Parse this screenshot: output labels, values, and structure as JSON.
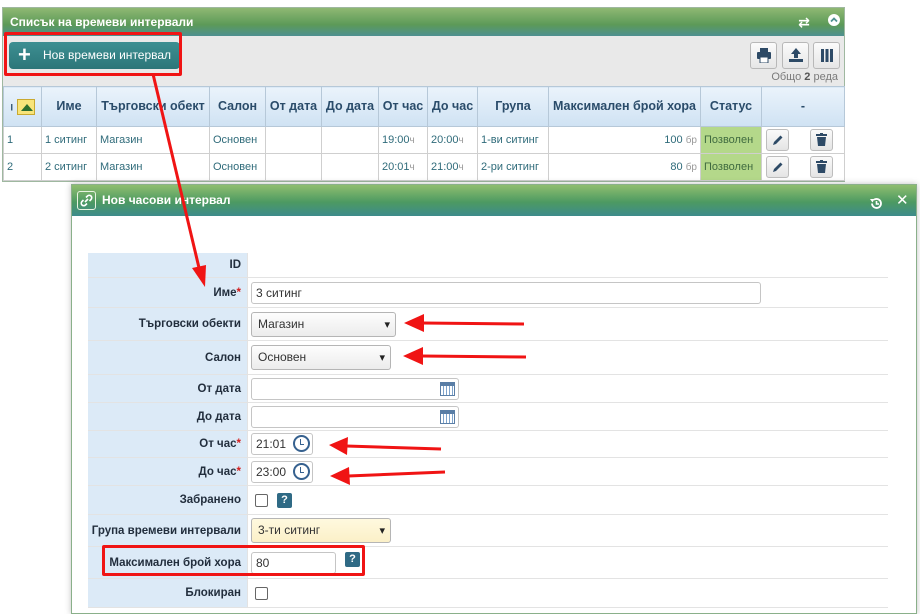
{
  "list_panel": {
    "title": "Списък на времеви интервали",
    "add_button_label": "Нов времеви интервал",
    "total_prefix": "Общо",
    "total_count": "2",
    "total_suffix": "реда",
    "columns": [
      "I",
      "Име",
      "Търговски обект",
      "Салон",
      "От дата",
      "До дата",
      "От час",
      "До час",
      "Група",
      "Максимален брой хора",
      "Статус",
      "-"
    ],
    "rows": [
      {
        "id": "1",
        "name": "1 ситинг",
        "shop": "Магазин",
        "salon": "Основен",
        "from_date": "",
        "to_date": "",
        "from_hour": "19:00",
        "to_hour": "20:00",
        "hour_unit": "ч",
        "group": "1-ви ситинг",
        "max_people": "100",
        "people_unit": "бр",
        "status": "Позволен"
      },
      {
        "id": "2",
        "name": "2 ситинг",
        "shop": "Магазин",
        "salon": "Основен",
        "from_date": "",
        "to_date": "",
        "from_hour": "20:01",
        "to_hour": "21:00",
        "hour_unit": "ч",
        "group": "2-ри ситинг",
        "max_people": "80",
        "people_unit": "бр",
        "status": "Позволен"
      }
    ]
  },
  "dialog": {
    "title": "Нов часови интервал",
    "fields": {
      "id_label": "ID",
      "name_label": "Име",
      "name_value": "3 ситинг",
      "shop_label": "Търговски обекти",
      "shop_value": "Магазин",
      "salon_label": "Салон",
      "salon_value": "Основен",
      "from_date_label": "От дата",
      "to_date_label": "До дата",
      "from_hour_label": "От час",
      "from_hour_value": "21:01",
      "to_hour_label": "До час",
      "to_hour_value": "23:00",
      "forbidden_label": "Забранено",
      "group_label": "Група времеви интервали",
      "group_value": "3-ти ситинг",
      "max_people_label": "Максимален брой хора",
      "max_people_value": "80",
      "blocked_label": "Блокиран",
      "required_mark": "*",
      "help_mark": "?"
    }
  },
  "colors": {
    "annotation": "#f01414",
    "header_green": "#5c9a58",
    "status_green": "#b4d88a"
  }
}
